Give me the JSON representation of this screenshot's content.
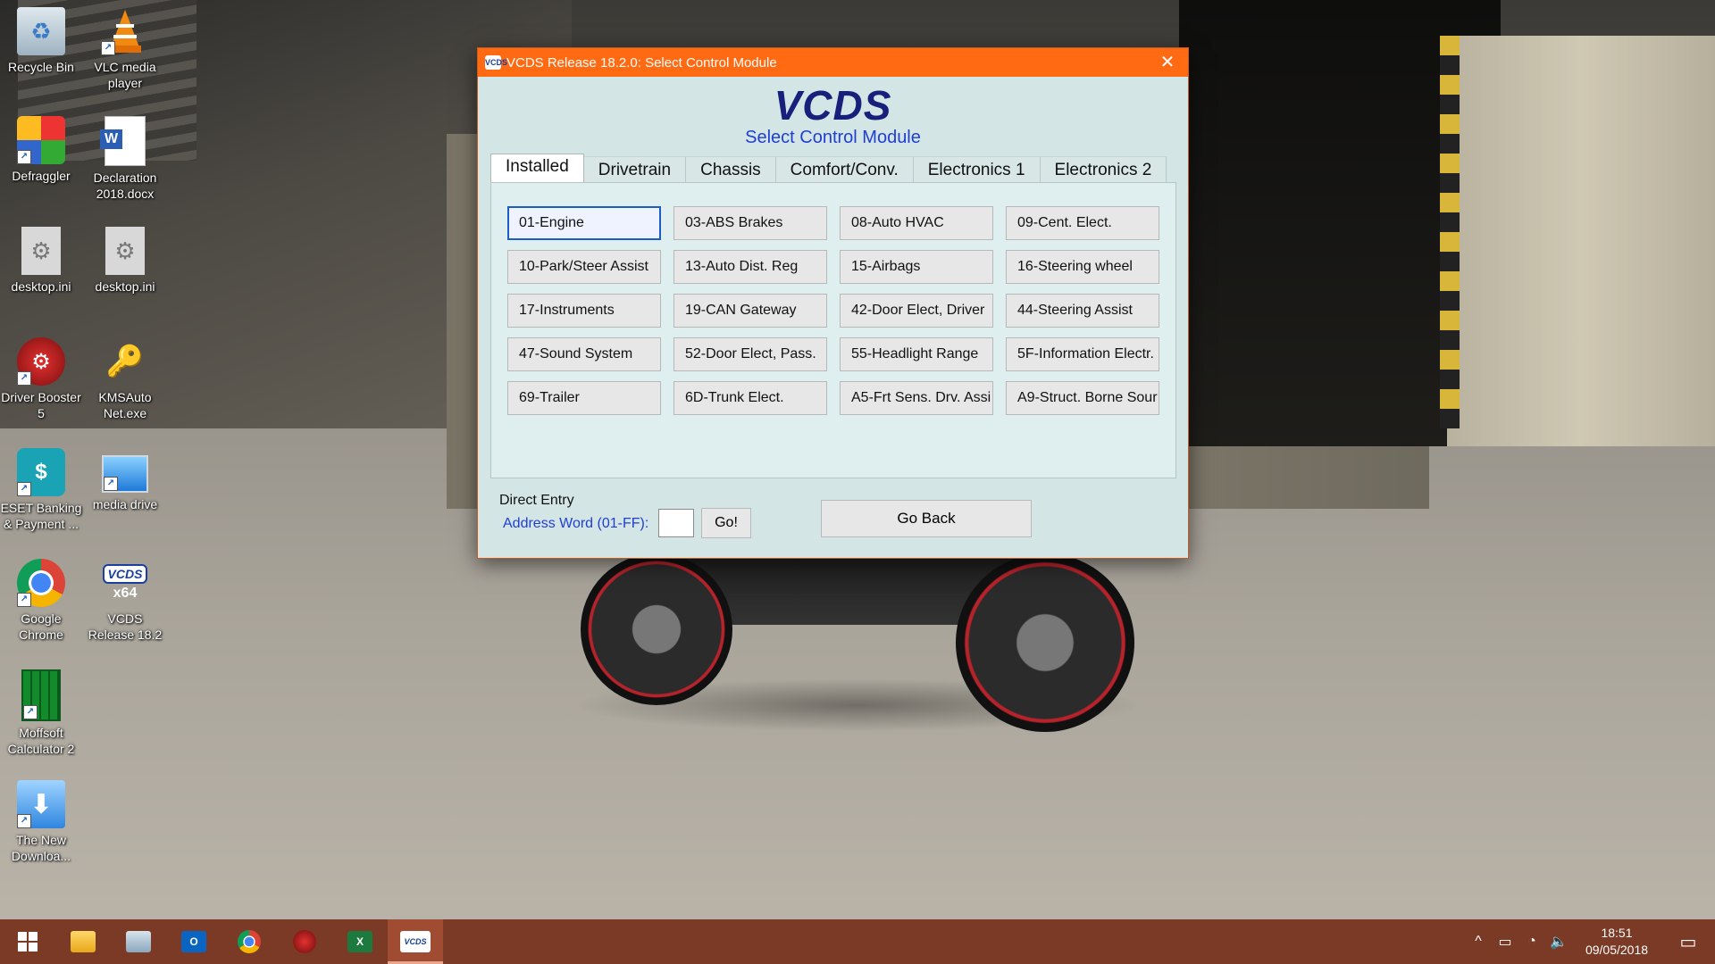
{
  "desktop": {
    "icons": [
      {
        "label": "Recycle Bin",
        "icon": "recycle-bin-icon"
      },
      {
        "label": "VLC media player",
        "icon": "vlc-icon"
      },
      {
        "label": "Defraggler",
        "icon": "defraggler-icon"
      },
      {
        "label": "Declaration 2018.docx",
        "icon": "word-document-icon"
      },
      {
        "label": "desktop.ini",
        "icon": "settings-file-icon"
      },
      {
        "label": "desktop.ini",
        "icon": "settings-file-icon"
      },
      {
        "label": "Driver Booster 5",
        "icon": "driver-booster-icon"
      },
      {
        "label": "KMSAuto Net.exe",
        "icon": "kmsauto-icon"
      },
      {
        "label": "ESET Banking & Payment ...",
        "icon": "eset-icon"
      },
      {
        "label": "media drive",
        "icon": "computer-icon"
      },
      {
        "label": "Google Chrome",
        "icon": "chrome-icon"
      },
      {
        "label": "VCDS Release 18.2",
        "icon": "vcds-icon",
        "badge": "x64"
      },
      {
        "label": "Moffsoft Calculator 2",
        "icon": "calculator-icon"
      },
      {
        "label": "The New Downloa...",
        "icon": "download-icon"
      }
    ]
  },
  "window": {
    "title": "VCDS Release 18.2.0:  Select Control Module",
    "close_glyph": "✕",
    "app_icon_text": "VCDS",
    "logo": "VCDS",
    "subtitle": "Select Control Module",
    "tabs": [
      {
        "label": "Installed",
        "active": true
      },
      {
        "label": "Drivetrain",
        "active": false
      },
      {
        "label": "Chassis",
        "active": false
      },
      {
        "label": "Comfort/Conv.",
        "active": false
      },
      {
        "label": "Electronics 1",
        "active": false
      },
      {
        "label": "Electronics 2",
        "active": false
      }
    ],
    "modules": [
      "01-Engine",
      "03-ABS Brakes",
      "08-Auto HVAC",
      "09-Cent. Elect.",
      "10-Park/Steer Assist",
      "13-Auto Dist. Reg",
      "15-Airbags",
      "16-Steering wheel",
      "17-Instruments",
      "19-CAN Gateway",
      "42-Door Elect, Driver",
      "44-Steering Assist",
      "47-Sound System",
      "52-Door Elect, Pass.",
      "55-Headlight Range",
      "5F-Information Electr.",
      "69-Trailer",
      "6D-Trunk Elect.",
      "A5-Frt Sens. Drv. Assi",
      "A9-Struct. Borne Sour"
    ],
    "focused_module": "01-Engine",
    "direct_entry_label": "Direct Entry",
    "address_word_label": "Address Word (01-FF):",
    "address_value": "",
    "go_label": "Go!",
    "go_back_label": "Go Back"
  },
  "taskbar": {
    "items": [
      {
        "icon": "windows-start-icon",
        "text": ""
      },
      {
        "icon": "file-explorer-icon",
        "text": ""
      },
      {
        "icon": "folder-icon",
        "text": ""
      },
      {
        "icon": "outlook-icon",
        "text": "O"
      },
      {
        "icon": "chrome-icon",
        "text": ""
      },
      {
        "icon": "driver-booster-icon",
        "text": ""
      },
      {
        "icon": "excel-icon",
        "text": "X"
      },
      {
        "icon": "vcds-icon",
        "text": "VCDS"
      }
    ],
    "active_item": "vcds-icon",
    "tray": {
      "chevron": "^",
      "time": "18:51",
      "date": "09/05/2018"
    }
  },
  "colors": {
    "titlebar": "#ff6a13",
    "window_bg": "#d4e5e5",
    "logo_text": "#17207a",
    "accent_blue": "#1f3fd2",
    "taskbar": "#7a3a26"
  }
}
